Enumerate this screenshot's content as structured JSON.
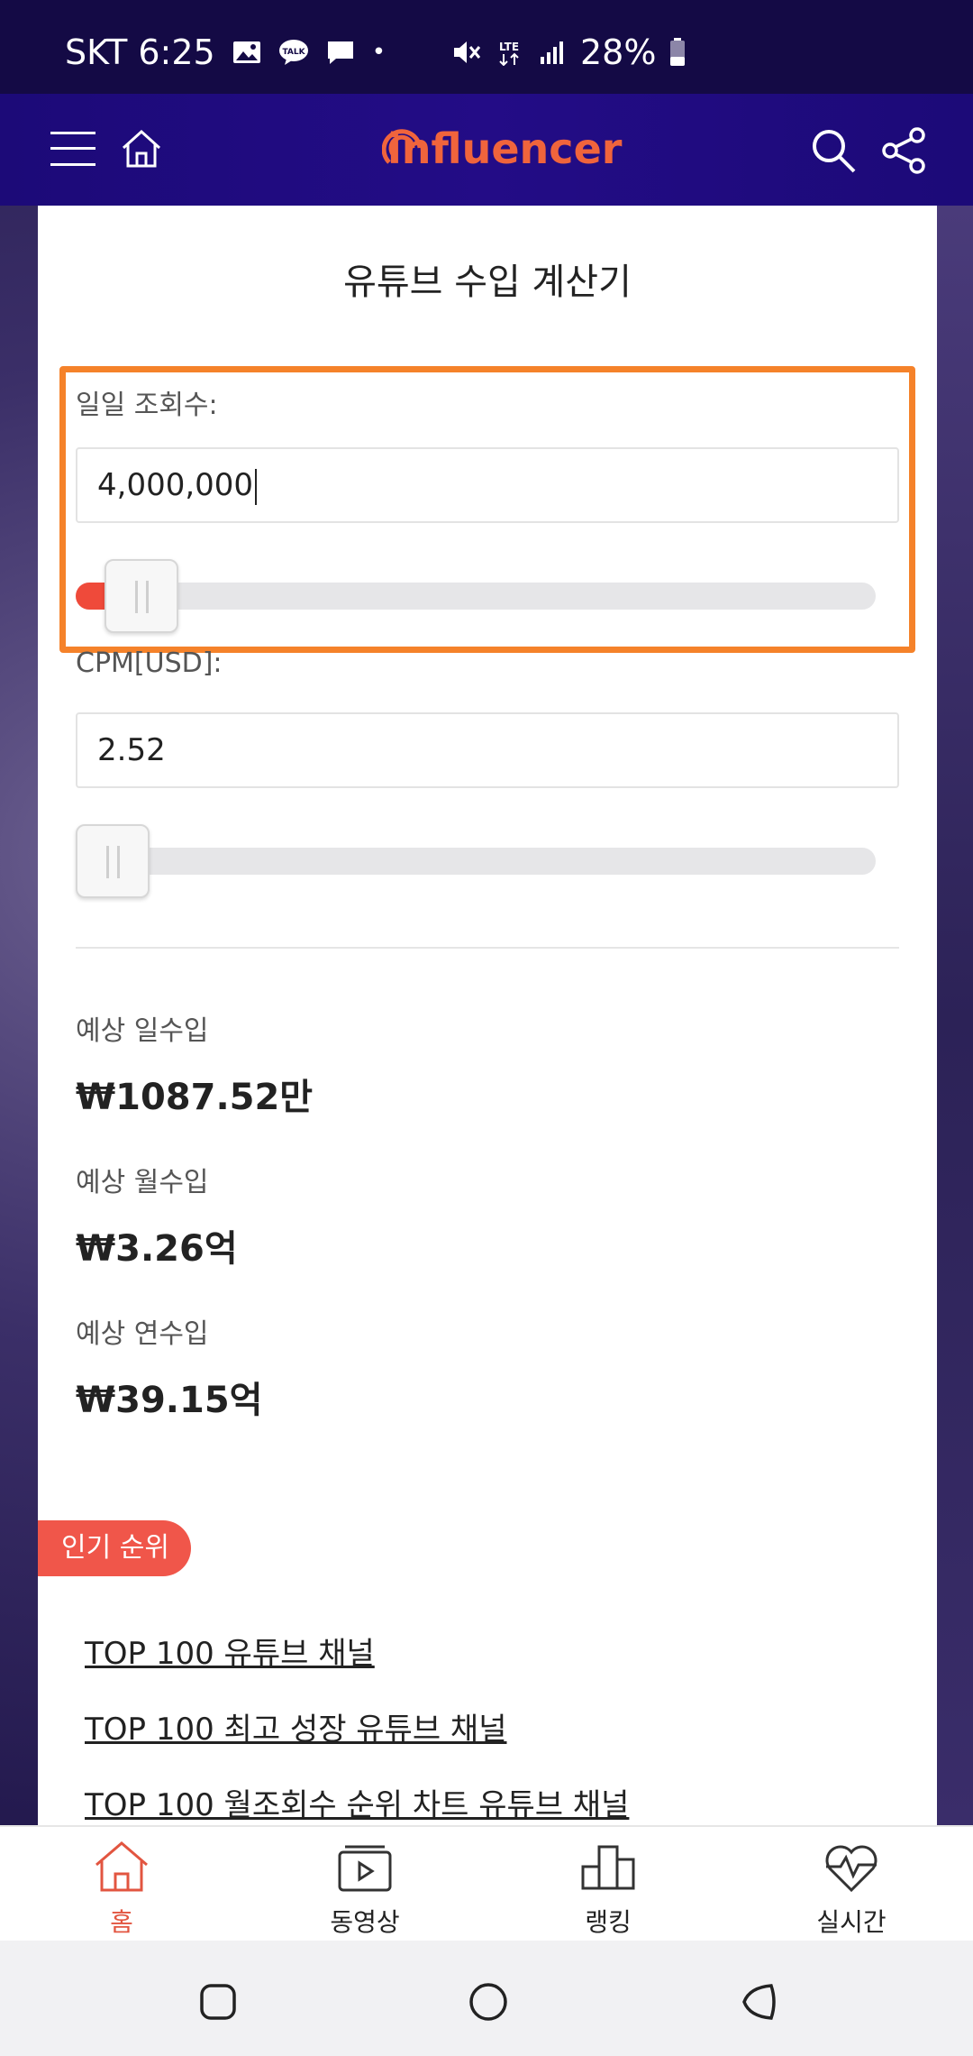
{
  "status_bar": {
    "carrier_time": "SKT 6:25",
    "dot": "•",
    "network": "LTE",
    "battery": "28%"
  },
  "app_bar": {
    "logo_text": "influencer"
  },
  "calculator": {
    "title": "유튜브 수입 계산기",
    "daily_views_label": "일일 조회수:",
    "daily_views_value": "4,000,000",
    "daily_views_slider_fraction": 0.04,
    "cpm_label": "CPM[USD]:",
    "cpm_value": "2.52",
    "cpm_slider_fraction": 0.0
  },
  "results": [
    {
      "label": "예상 일수입",
      "value": "₩1087.52만"
    },
    {
      "label": "예상 월수입",
      "value": "₩3.26억"
    },
    {
      "label": "예상 연수입",
      "value": "₩39.15억"
    }
  ],
  "ranking": {
    "badge": "인기 순위",
    "links": [
      "TOP 100 유튜브 채널",
      "TOP 100 최고 성장 유튜브 채널",
      "TOP 100 월조회수 순위 차트 유튜브 채널"
    ]
  },
  "bottom_nav": [
    {
      "label": "홈",
      "icon": "home-icon",
      "active": true
    },
    {
      "label": "동영상",
      "icon": "video-icon",
      "active": false
    },
    {
      "label": "랭킹",
      "icon": "ranking-icon",
      "active": false
    },
    {
      "label": "실시간",
      "icon": "heartbeat-icon",
      "active": false
    }
  ],
  "colors": {
    "app_bar": "#1c0a78",
    "accent_red": "#ef4a3a",
    "highlight_orange": "#f5822a",
    "logo_orange": "#f0643c"
  }
}
